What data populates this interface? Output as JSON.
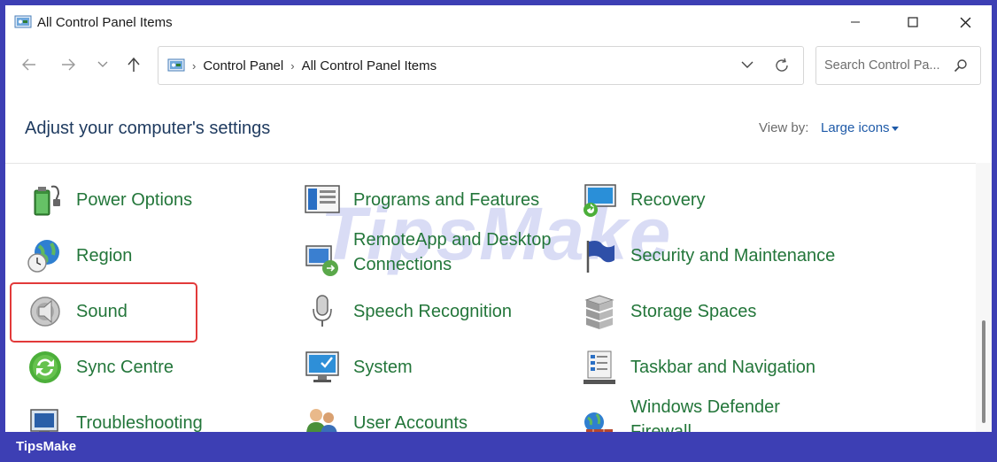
{
  "window": {
    "title": "All Control Panel Items",
    "minimize_icon": "minimize-icon",
    "maximize_icon": "maximize-icon",
    "close_icon": "close-icon"
  },
  "nav": {
    "back_icon": "arrow-left-icon",
    "forward_icon": "arrow-right-icon",
    "recent_icon": "chevron-down-icon",
    "up_icon": "arrow-up-icon"
  },
  "address": {
    "crumbs": [
      "Control Panel",
      "All Control Panel Items"
    ],
    "separator": "›"
  },
  "search": {
    "placeholder": "Search Control Pa..."
  },
  "header": {
    "title": "Adjust your computer's settings",
    "view_by_label": "View by:",
    "view_by_value": "Large icons"
  },
  "items": [
    {
      "label": "Power Options",
      "icon": "battery-plug-icon"
    },
    {
      "label": "Region",
      "icon": "globe-clock-icon"
    },
    {
      "label": "Sound",
      "icon": "speaker-icon"
    },
    {
      "label": "Sync Centre",
      "icon": "sync-icon"
    },
    {
      "label": "Troubleshooting",
      "icon": "troubleshoot-icon"
    },
    {
      "label": "Programs and Features",
      "icon": "programs-icon"
    },
    {
      "label": "RemoteApp and Desktop Connections",
      "icon": "remote-desktop-icon"
    },
    {
      "label": "Speech Recognition",
      "icon": "microphone-icon"
    },
    {
      "label": "System",
      "icon": "system-monitor-icon"
    },
    {
      "label": "User Accounts",
      "icon": "users-icon"
    },
    {
      "label": "Recovery",
      "icon": "recovery-icon"
    },
    {
      "label": "Security and Maintenance",
      "icon": "flag-icon"
    },
    {
      "label": "Storage Spaces",
      "icon": "storage-icon"
    },
    {
      "label": "Taskbar and Navigation",
      "icon": "taskbar-icon"
    },
    {
      "label": "Windows Defender Firewall",
      "icon": "firewall-icon"
    }
  ],
  "watermark": "TipsMake",
  "brand": "TipsMake",
  "colors": {
    "link_green": "#23763a",
    "heading_blue": "#1e3a5f",
    "frame": "#3d3fb4",
    "highlight": "#e23a3a"
  }
}
